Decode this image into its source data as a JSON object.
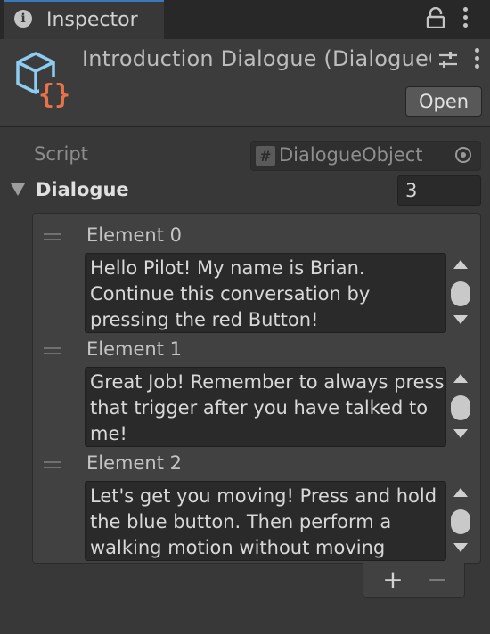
{
  "window": {
    "tab_title": "Inspector",
    "tab_icon": "info-icon"
  },
  "header": {
    "object_title": "Introduction Dialogue (DialogueObject)",
    "object_icon": "scriptable-object-icon",
    "open_button": "Open"
  },
  "script": {
    "label": "Script",
    "value": "DialogueObject",
    "type_glyph": "#"
  },
  "dialogue": {
    "label": "Dialogue",
    "count": "3",
    "elements": [
      {
        "label": "Element 0",
        "text": "Hello Pilot! My name is Brian. Continue this conversation by pressing the red Button!"
      },
      {
        "label": "Element 1",
        "text": "Great Job! Remember to always press that trigger after you have talked to me!"
      },
      {
        "label": "Element 2",
        "text": "Let's get you moving! Press and hold the blue button. Then perform a walking motion without moving"
      }
    ],
    "add_glyph": "+",
    "remove_glyph": "−"
  },
  "colors": {
    "background": "#383838",
    "tab_accent": "#3a79bb",
    "icon_blue": "#8ecdf2",
    "icon_orange": "#e8734a"
  }
}
